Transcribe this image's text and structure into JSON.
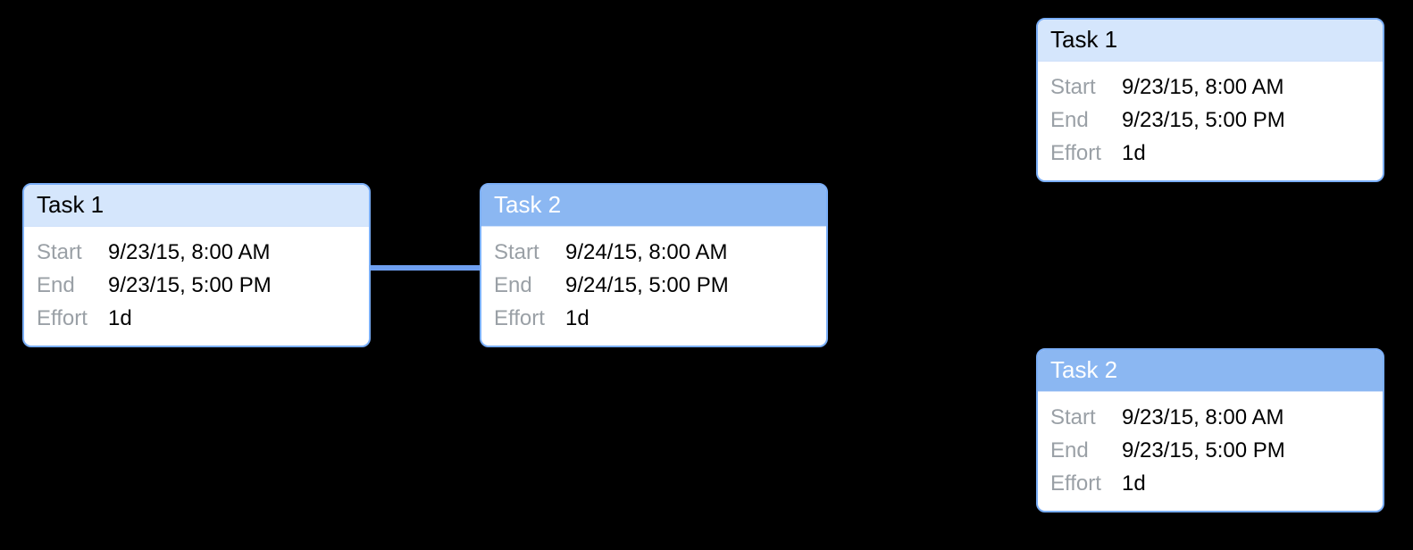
{
  "labels": {
    "start": "Start",
    "end": "End",
    "effort": "Effort"
  },
  "left": {
    "task1": {
      "title": "Task 1",
      "start": "9/23/15, 8:00 AM",
      "end": "9/23/15, 5:00 PM",
      "effort": "1d"
    },
    "task2": {
      "title": "Task 2",
      "start": "9/24/15, 8:00 AM",
      "end": "9/24/15, 5:00 PM",
      "effort": "1d"
    }
  },
  "right": {
    "task1": {
      "title": "Task 1",
      "start": "9/23/15, 8:00 AM",
      "end": "9/23/15, 5:00 PM",
      "effort": "1d"
    },
    "task2": {
      "title": "Task 2",
      "start": "9/23/15, 8:00 AM",
      "end": "9/23/15, 5:00 PM",
      "effort": "1d"
    }
  }
}
